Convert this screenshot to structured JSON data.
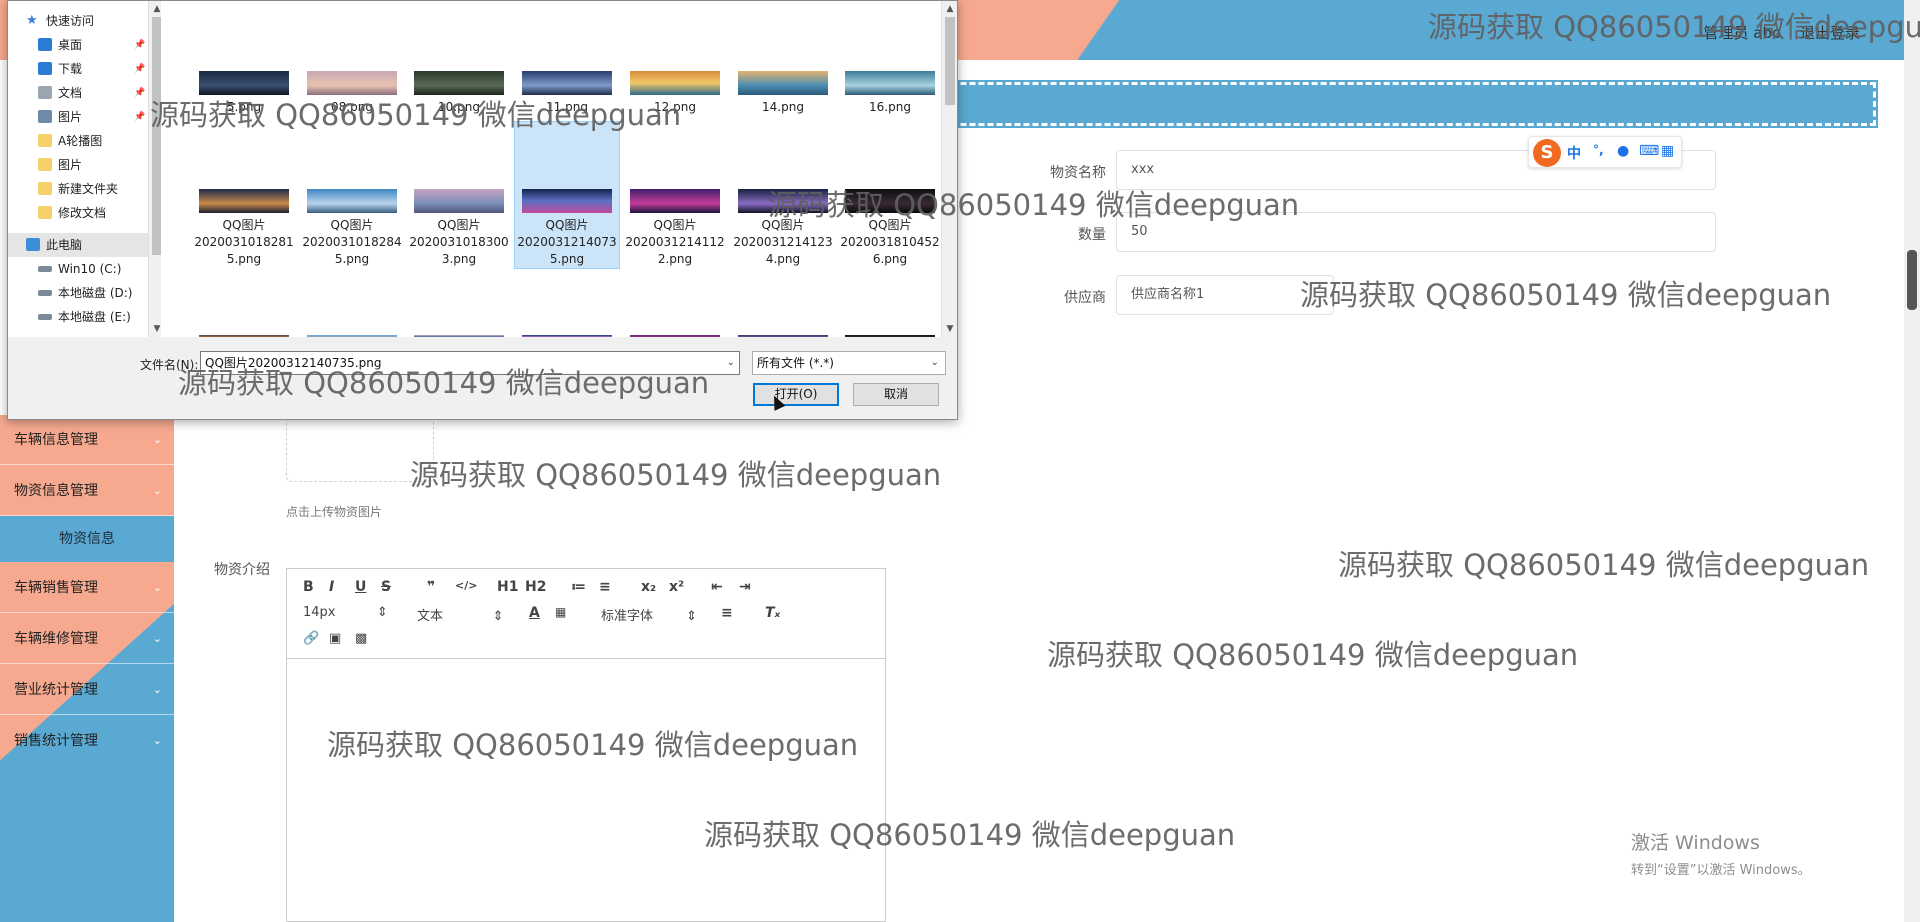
{
  "header": {
    "user": "管理员 abo",
    "logout": "退出登录"
  },
  "sidebar": {
    "items": [
      {
        "label": "车辆信息管理"
      },
      {
        "label": "物资信息管理"
      },
      {
        "label": "物资信息"
      },
      {
        "label": "车辆销售管理"
      },
      {
        "label": "车辆维修管理"
      },
      {
        "label": "营业统计管理"
      },
      {
        "label": "销售统计管理"
      }
    ]
  },
  "form": {
    "name_label": "物资名称",
    "name_value": "xxx",
    "qty_label": "数量",
    "qty_value": "50",
    "supplier_label": "供应商",
    "supplier_value": "供应商名称1",
    "upload_hint": "点击上传物资图片",
    "intro_label": "物资介绍"
  },
  "editor": {
    "font_size": "14px",
    "text_style": "文本",
    "font_family": "标准字体",
    "buttons": [
      "B",
      "I",
      "U",
      "S",
      "❞",
      "</>",
      "H1",
      "H2",
      "≔",
      "≡",
      "x₂",
      "x²",
      "⇤",
      "⇥"
    ]
  },
  "ime": {
    "logo": "S",
    "cn": "中"
  },
  "activate_windows": {
    "line1": "激活 Windows",
    "line2": "转到“设置”以激活 Windows。"
  },
  "dialog": {
    "nav_items": [
      {
        "label": "快速访问",
        "icon": "star-icon"
      },
      {
        "label": "桌面",
        "icon": "desktop-icon"
      },
      {
        "label": "下载",
        "icon": "download-icon"
      },
      {
        "label": "文档",
        "icon": "document-icon"
      },
      {
        "label": "图片",
        "icon": "picture-icon"
      },
      {
        "label": "A轮播图",
        "icon": "folder-icon"
      },
      {
        "label": "图片",
        "icon": "folder-icon"
      },
      {
        "label": "新建文件夹",
        "icon": "folder-icon"
      },
      {
        "label": "修改文档",
        "icon": "folder-icon"
      },
      {
        "label": "此电脑",
        "icon": "computer-icon"
      },
      {
        "label": "Win10 (C:)",
        "icon": "drive-icon"
      },
      {
        "label": "本地磁盘 (D:)",
        "icon": "drive-icon"
      },
      {
        "label": "本地磁盘 (E:)",
        "icon": "drive-icon"
      }
    ],
    "files_row1": [
      "5.png",
      "08.png",
      "10.png",
      "11.png",
      "12.png",
      "14.png",
      "16.png"
    ],
    "files_row2": [
      "QQ图片\n2020031018281\n5.png",
      "QQ图片\n2020031018284\n5.png",
      "QQ图片\n2020031018300\n3.png",
      "QQ图片\n2020031214073\n5.png",
      "QQ图片\n2020031214112\n2.png",
      "QQ图片\n2020031214123\n4.png",
      "QQ图片\n2020031810452\n6.png"
    ],
    "selected_index": 3,
    "filename_label": "文件名(N):",
    "filename_value": "QQ图片20200312140735.png",
    "filetype_value": "所有文件 (*.*)",
    "open_label": "打开(O)",
    "cancel_label": "取消"
  },
  "watermark": "源码获取 QQ86050149 微信deepguan"
}
